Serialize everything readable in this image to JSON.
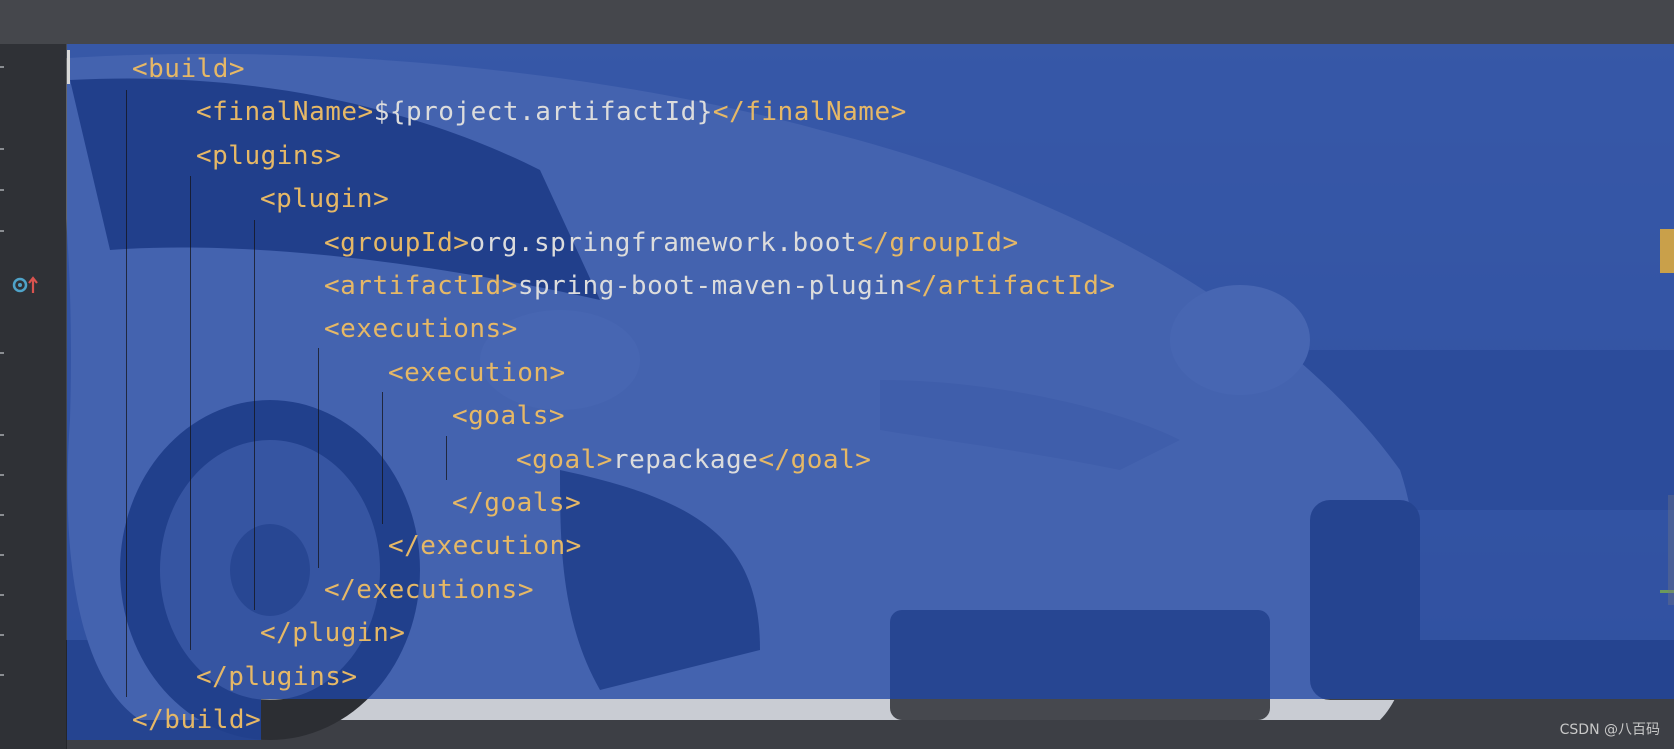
{
  "editor": {
    "language": "xml",
    "lines": [
      {
        "indent": 1,
        "tag_open": "<build>",
        "text": "",
        "tag_close": ""
      },
      {
        "indent": 2,
        "tag_open": "<finalName>",
        "text": "${project.artifactId}",
        "tag_close": "</finalName>"
      },
      {
        "indent": 2,
        "tag_open": "<plugins>",
        "text": "",
        "tag_close": ""
      },
      {
        "indent": 3,
        "tag_open": "<plugin>",
        "text": "",
        "tag_close": ""
      },
      {
        "indent": 4,
        "tag_open": "<groupId>",
        "text": "org.springframework.boot",
        "tag_close": "</groupId>"
      },
      {
        "indent": 4,
        "tag_open": "<artifactId>",
        "text": "spring-boot-maven-plugin",
        "tag_close": "</artifactId>"
      },
      {
        "indent": 4,
        "tag_open": "<executions>",
        "text": "",
        "tag_close": ""
      },
      {
        "indent": 5,
        "tag_open": "<execution>",
        "text": "",
        "tag_close": ""
      },
      {
        "indent": 6,
        "tag_open": "<goals>",
        "text": "",
        "tag_close": ""
      },
      {
        "indent": 7,
        "tag_open": "<goal>",
        "text": "repackage",
        "tag_close": "</goal>"
      },
      {
        "indent": 6,
        "tag_open": "</goals>",
        "text": "",
        "tag_close": ""
      },
      {
        "indent": 5,
        "tag_open": "</execution>",
        "text": "",
        "tag_close": ""
      },
      {
        "indent": 4,
        "tag_open": "</executions>",
        "text": "",
        "tag_close": ""
      },
      {
        "indent": 3,
        "tag_open": "</plugin>",
        "text": "",
        "tag_close": ""
      },
      {
        "indent": 2,
        "tag_open": "</plugins>",
        "text": "",
        "tag_close": ""
      },
      {
        "indent": 1,
        "tag_open": "</build>",
        "text": "",
        "tag_close": ""
      }
    ]
  },
  "gutter": {
    "icon": "implements-override-icon"
  },
  "watermark": "CSDN @八百码",
  "colors": {
    "tag": "#e6b866",
    "text": "#dcdcdc",
    "selection": "#1f45a5",
    "warning_mark": "#c9a04a"
  }
}
